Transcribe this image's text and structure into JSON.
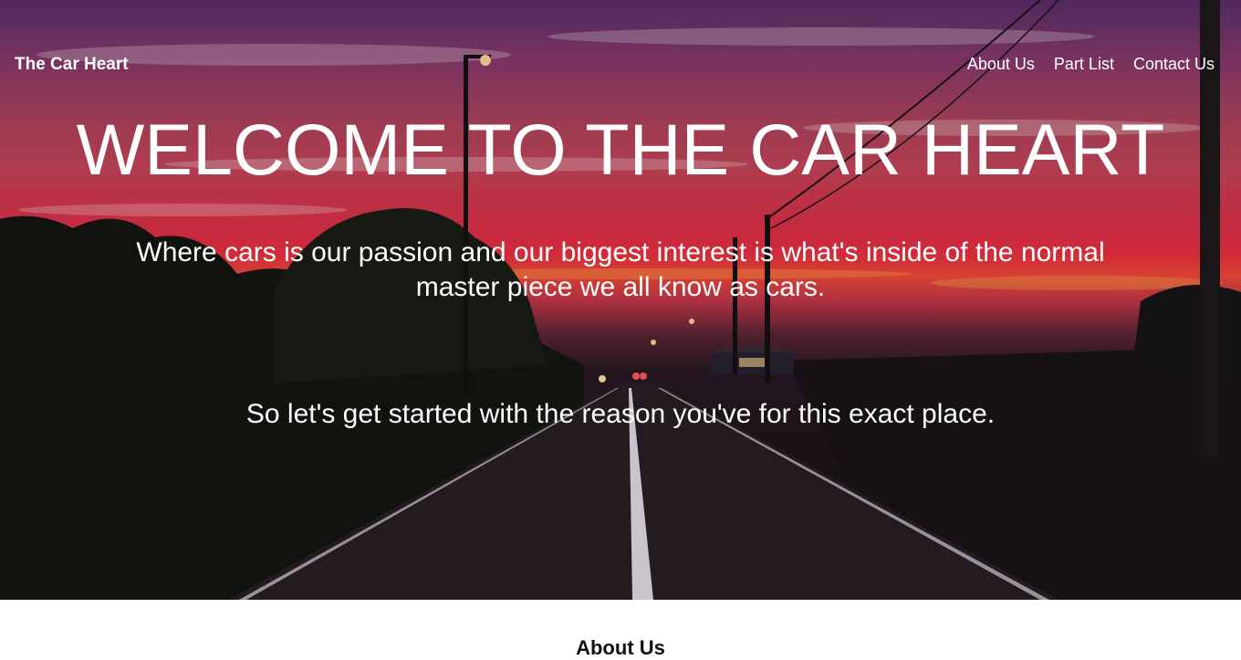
{
  "brand": "The Car Heart",
  "nav": {
    "about": "About Us",
    "parts": "Part List",
    "contact": "Contact Us"
  },
  "hero": {
    "title": "WELCOME TO THE CAR HEART",
    "subtitle": "Where cars is our passion and our biggest interest is what's inside of the normal master piece we all know as cars.",
    "cta": "So let's get started with the reason you've for this exact place."
  },
  "about": {
    "heading": "About Us"
  },
  "colors": {
    "hero_text": "#ffffff",
    "sunset_red": "#ee2f43",
    "sky_purple": "#5a2e6a",
    "road_dark": "#18131a"
  }
}
